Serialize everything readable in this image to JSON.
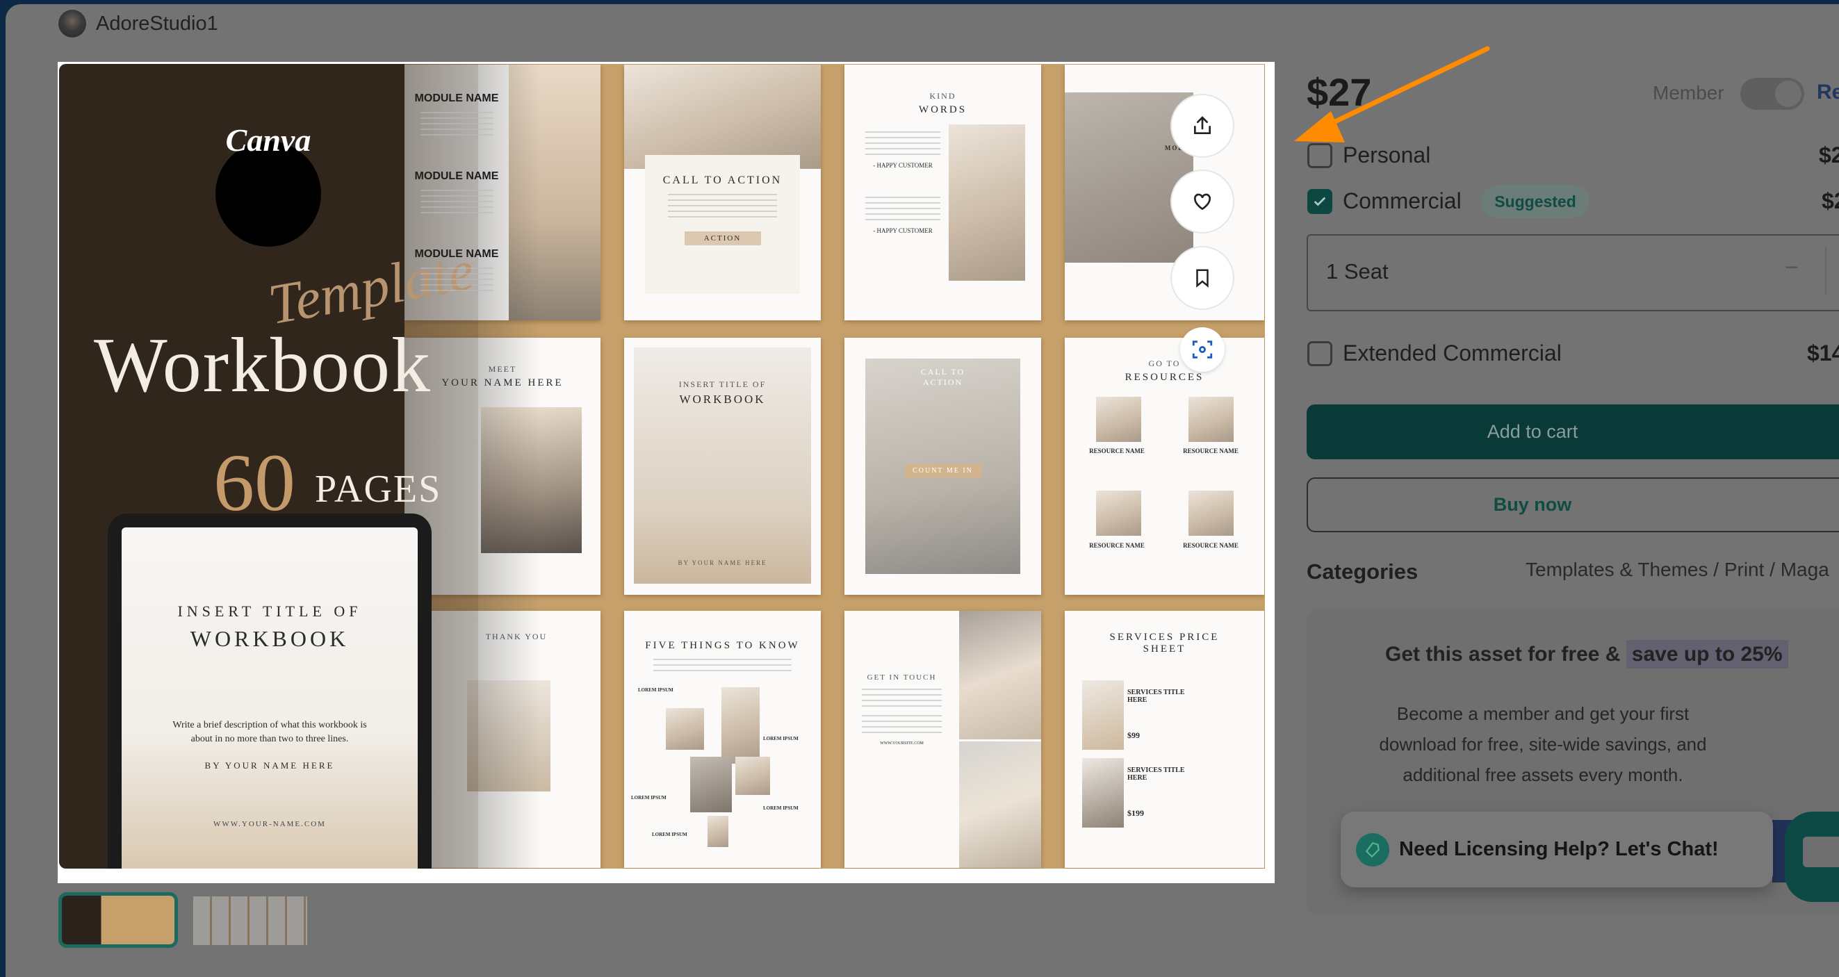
{
  "seller": {
    "name": "AdoreStudio1"
  },
  "product_image": {
    "logo": "Canva",
    "script_title": "Template",
    "title": "Workbook",
    "page_count": "60",
    "pages_label": "PAGES",
    "tablet": {
      "line1": "INSERT TITLE OF",
      "line2": "WORKBOOK",
      "desc": "Write a brief description of what this workbook is about in no more than two to three lines.",
      "byline": "BY YOUR NAME HERE",
      "url": "WWW.YOUR-NAME.COM"
    },
    "pages": {
      "module": [
        "MODULE NAME",
        "MODULE NAME",
        "MODULE NAME"
      ],
      "cta": {
        "title": "CALL TO ACTION",
        "button": "ACTION"
      },
      "kind": {
        "t1": "KIND",
        "t2": "WORDS",
        "who": "- HAPPY CUSTOMER"
      },
      "module_one": "MODULE ONE",
      "meet": {
        "t1": "MEET",
        "t2": "YOUR NAME HERE"
      },
      "insert": {
        "t1": "INSERT TITLE OF",
        "t2": "WORKBOOK",
        "by": "BY YOUR NAME HERE"
      },
      "cta2": {
        "t1": "CALL TO",
        "t2": "ACTION",
        "button": "COUNT ME IN"
      },
      "resources": {
        "t1": "GO TO",
        "t2": "RESOURCES",
        "item": "RESOURCE NAME"
      },
      "thanks": "THANK YOU",
      "five": {
        "title": "FIVE THINGS TO KNOW",
        "item": "LOREM IPSUM"
      },
      "touch": {
        "title": "GET IN TOUCH",
        "url": "WWW.YOURSITE.COM"
      },
      "services": {
        "title": "SERVICES PRICE SHEET",
        "item": "SERVICES TITLE HERE",
        "p1": "$99",
        "p2": "$199"
      }
    },
    "actions": {
      "share": "share-icon",
      "favorite": "heart-icon",
      "save": "bookmark-icon",
      "visual_search": "scan-icon"
    }
  },
  "pricing": {
    "price": "$27",
    "member_label": "Member",
    "member_toggle_on": false,
    "retail_label": "Re",
    "licenses": [
      {
        "label": "Personal",
        "price": "$2",
        "checked": false
      },
      {
        "label": "Commercial",
        "badge": "Suggested",
        "price": "$2",
        "checked": true
      },
      {
        "label": "Extended Commercial",
        "price": "$14",
        "checked": false
      }
    ],
    "seat": {
      "label": "1 Seat",
      "decrement": "−"
    },
    "add_to_cart": "Add to cart",
    "buy_now": "Buy now"
  },
  "categories": {
    "label": "Categories",
    "path": "Templates & Themes / Print / Maga"
  },
  "promo": {
    "title": "Get this asset for free &",
    "highlight": "save up to 25%",
    "text": "Become a member and get your first download for free, site-wide savings, and additional free assets every month."
  },
  "chat": {
    "label": "Need Licensing Help? Let's Chat!"
  },
  "colors": {
    "accent": "#0a3a37",
    "annotation_arrow": "#ff8c00",
    "dark_blue_frame": "#0c2a45"
  }
}
